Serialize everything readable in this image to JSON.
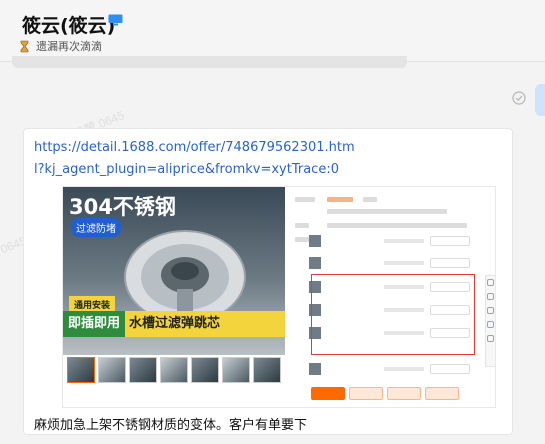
{
  "header": {
    "contact_name": "筱云(筱云)",
    "status_text": "遗漏再次滴滴",
    "status_icon": "hourglass-icon",
    "device_icon": "monitor-icon"
  },
  "watermarks": [
    "黄佳赞 0645",
    "0645",
    "1688"
  ],
  "message": {
    "link": "https://detail.1688.com/offer/748679562301.html?kj_agent_plugin=aliprice&fromkv=xytTrace:0",
    "caption": "麻烦加急上架不锈钢材质的变体。客户有单要下"
  },
  "product_shot": {
    "title": "304不锈钢",
    "badge_top": "过滤防堵",
    "badge_yellow": "通用安装",
    "bar_green": "即插即用",
    "bar_text": "水槽过滤弹跳芯"
  },
  "colors": {
    "link": "#2a64c8",
    "highlight_box": "#e23a3a",
    "order_button": "#ff6a00",
    "status_bubble": "#cfe3fb"
  }
}
